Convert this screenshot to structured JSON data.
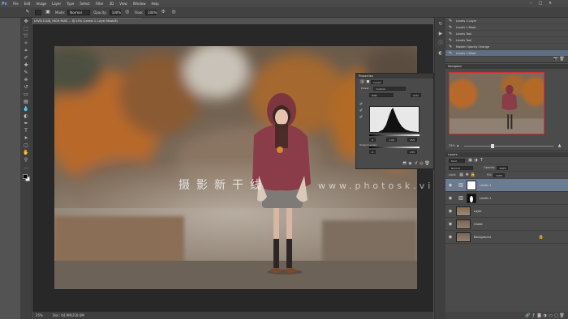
{
  "app": {
    "logo": "Ps",
    "menu": [
      "File",
      "Edit",
      "Image",
      "Layer",
      "Type",
      "Select",
      "Filter",
      "3D",
      "View",
      "Window",
      "Help"
    ],
    "window_controls": [
      "–",
      "□",
      "×"
    ]
  },
  "options_bar": {
    "mode_label": "Mode:",
    "mode_value": "Normal",
    "opacity_label": "Opacity:",
    "opacity_value": "100%",
    "flow_label": "Flow:",
    "flow_value": "100%"
  },
  "document": {
    "tab_title": "LEVELS ADJ, HIGH PASS ... @ 25% (Levels 1, Layer Mask/8)",
    "zoom": "25%",
    "doc_info": "Doc: 64.9M/218.0M"
  },
  "watermark": {
    "cn": "摄影新干线",
    "url": "www.photosk.vip"
  },
  "properties_panel": {
    "title": "Properties",
    "tabs": [
      "Levels"
    ],
    "preset_label": "Preset:",
    "preset_value": "Custom",
    "channel_value": "RGB",
    "auto_label": "Auto",
    "input_values": [
      "0",
      "1.00",
      "255"
    ],
    "output_label": "Output Levels:",
    "output_values": [
      "0",
      "255"
    ]
  },
  "history_panel": {
    "items": [
      {
        "label": "Levels 1 Layer",
        "active": false
      },
      {
        "label": "Levels 1 Mask",
        "active": false
      },
      {
        "label": "Levels Tool",
        "active": false
      },
      {
        "label": "Levels Tool",
        "active": false
      },
      {
        "label": "Master Opacity Change",
        "active": false
      },
      {
        "label": "Levels 1 Mask",
        "active": true
      }
    ]
  },
  "navigator_panel": {
    "title": "Navigator",
    "zoom": "25%"
  },
  "layers_panel": {
    "title": "Layers",
    "kind_label": "Kind",
    "blend_mode": "Normal",
    "opacity_label": "Opacity:",
    "opacity_value": "100%",
    "lock_label": "Lock:",
    "fill_label": "Fill:",
    "fill_value": "100%",
    "layers": [
      {
        "name": "Levels 1",
        "type": "adjustment",
        "active": true
      },
      {
        "name": "Levels 1",
        "type": "adjustment-dark",
        "active": false
      },
      {
        "name": "Layer",
        "type": "photo",
        "active": false
      },
      {
        "name": "Grade",
        "type": "photo",
        "active": false
      },
      {
        "name": "Background",
        "type": "photo",
        "active": false
      }
    ]
  },
  "colors": {
    "accent": "#6b7b91",
    "frame": "#cc3333"
  },
  "icons": {
    "ps": "ps-logo-icon",
    "eye": "eye-icon",
    "lock": "lock-icon",
    "adjust": "adjustment-icon"
  }
}
